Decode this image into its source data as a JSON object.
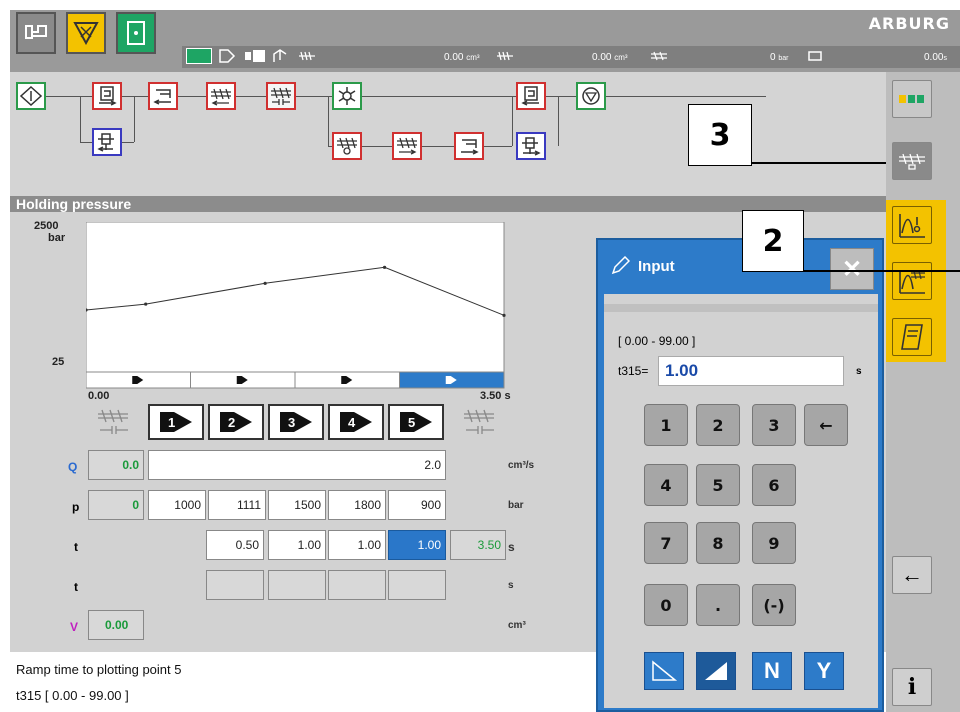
{
  "brand": "ARBURG",
  "status": {
    "vol1": "0.00",
    "vol1_unit": "cm³",
    "vol2": "0.00",
    "vol2_unit": "cm³",
    "pressure": "0",
    "pressure_unit": "bar",
    "last": "0.00",
    "last_unit": "s"
  },
  "callouts": {
    "a": "3",
    "b": "2"
  },
  "section_title": "Holding pressure",
  "chart_data": {
    "type": "line",
    "ymax_label": "2500",
    "ymax_unit": "bar",
    "ymin_label": "25",
    "xmin_label": "0.00",
    "xmax_label": "3.50",
    "xmax_unit": "s",
    "x": [
      0,
      0.5,
      1.5,
      2.5,
      3.5
    ],
    "y": [
      1000,
      1111,
      1500,
      1800,
      900
    ],
    "ylim": [
      25,
      2500
    ],
    "xlim": [
      0,
      3.5
    ],
    "segments": 4,
    "selected_segment": 4
  },
  "table": {
    "point_labels": [
      "1",
      "2",
      "3",
      "4",
      "5"
    ],
    "q": {
      "label": "Q",
      "start": "0.0",
      "value": "2.0",
      "unit": "cm³/s"
    },
    "p": {
      "label": "p",
      "start": "0",
      "values": [
        "1000",
        "1111",
        "1500",
        "1800",
        "900"
      ],
      "unit": "bar"
    },
    "t": {
      "label": "t",
      "values": [
        "0.50",
        "1.00",
        "1.00",
        "1.00"
      ],
      "total": "3.50",
      "unit": "s"
    },
    "t2": {
      "label": "t",
      "unit": "s"
    },
    "v": {
      "label": "V",
      "value": "0.00",
      "unit": "cm³"
    }
  },
  "footer": {
    "line1": "Ramp time to plotting point 5",
    "line2": "t315 [ 0.00 - 99.00 ]"
  },
  "dialog": {
    "title": "Input",
    "close": "✕",
    "range": "[ 0.00 - 99.00 ]",
    "param": "t315=",
    "value": "1.00",
    "unit": "s",
    "keys": [
      "1",
      "2",
      "3",
      "←",
      "4",
      "5",
      "6",
      "7",
      "8",
      "9",
      "0",
      ".",
      "(-)"
    ],
    "n_label": "N",
    "y_label": "Y"
  },
  "right_toolbar": {
    "back": "←",
    "info": "i"
  },
  "colors": {
    "accent_blue": "#2d7bc9",
    "yellow": "#f3c200",
    "green": "#1ea564",
    "q_color": "#2a6ad0",
    "v_color": "#c020c0"
  }
}
